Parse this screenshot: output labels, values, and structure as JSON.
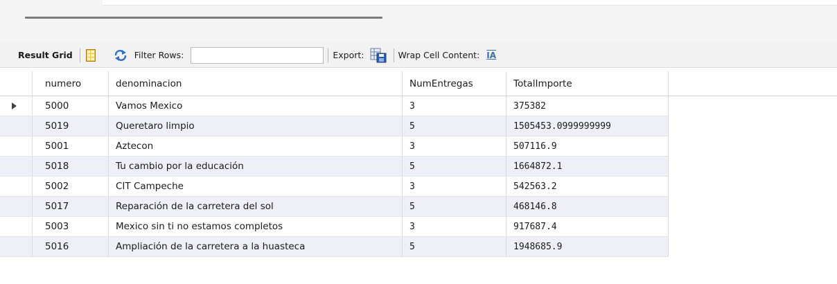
{
  "toolbar": {
    "result_grid": "Result Grid",
    "filter_rows": "Filter Rows:",
    "filter_value": "",
    "export": "Export:",
    "wrap_cell": "Wrap Cell Content:",
    "wrap_icon": "IA"
  },
  "grid": {
    "columns": [
      "numero",
      "denominacion",
      "NumEntregas",
      "TotalImporte"
    ],
    "rows": [
      {
        "numero": "5000",
        "denominacion": "Vamos Mexico",
        "entregas": "3",
        "importe": "375382",
        "current": true
      },
      {
        "numero": "5019",
        "denominacion": "Queretaro limpio",
        "entregas": "5",
        "importe": "1505453.0999999999"
      },
      {
        "numero": "5001",
        "denominacion": "Aztecon",
        "entregas": "3",
        "importe": "507116.9"
      },
      {
        "numero": "5018",
        "denominacion": "Tu cambio por la educación",
        "entregas": "5",
        "importe": "1664872.1"
      },
      {
        "numero": "5002",
        "denominacion": "CIT Campeche",
        "entregas": "3",
        "importe": "542563.2"
      },
      {
        "numero": "5017",
        "denominacion": "Reparación de la carretera del sol",
        "entregas": "5",
        "importe": "468146.8"
      },
      {
        "numero": "5003",
        "denominacion": "Mexico sin ti no estamos completos",
        "entregas": "3",
        "importe": "917687.4"
      },
      {
        "numero": "5016",
        "denominacion": "Ampliación de la carretera a la huasteca",
        "entregas": "5",
        "importe": "1948685.9"
      }
    ]
  },
  "colors": {
    "row_alt": "#eef0f8",
    "accent": "#3a6ea5"
  }
}
